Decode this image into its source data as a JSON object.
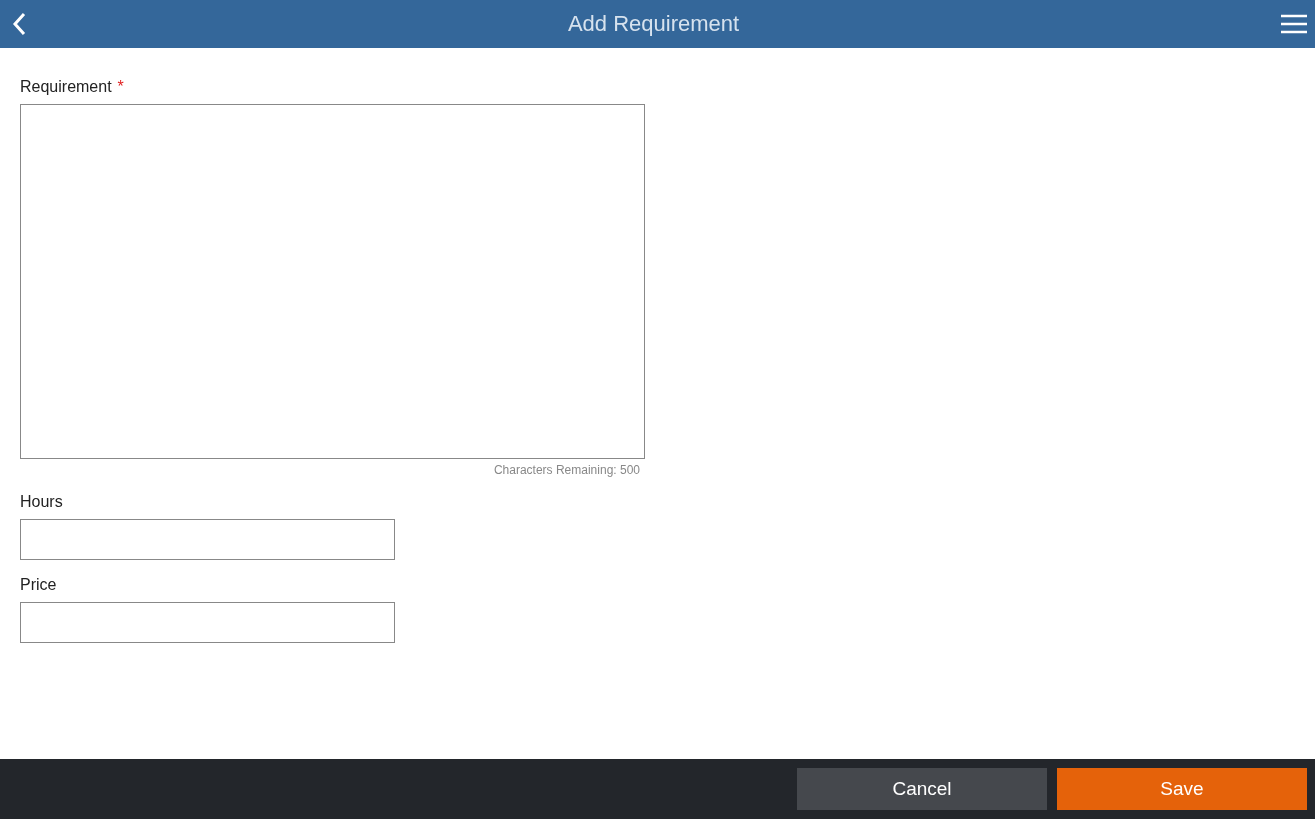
{
  "header": {
    "title": "Add Requirement"
  },
  "requirement": {
    "label": "Requirement",
    "marker": "*",
    "required": true,
    "counter": "Characters Remaining: 500"
  },
  "fields": [
    {
      "label": "Hours"
    },
    {
      "label": "Price"
    }
  ],
  "buttons": [
    {
      "label": "Cancel",
      "kind": "secondary"
    },
    {
      "label": "Save",
      "kind": "primary"
    }
  ]
}
